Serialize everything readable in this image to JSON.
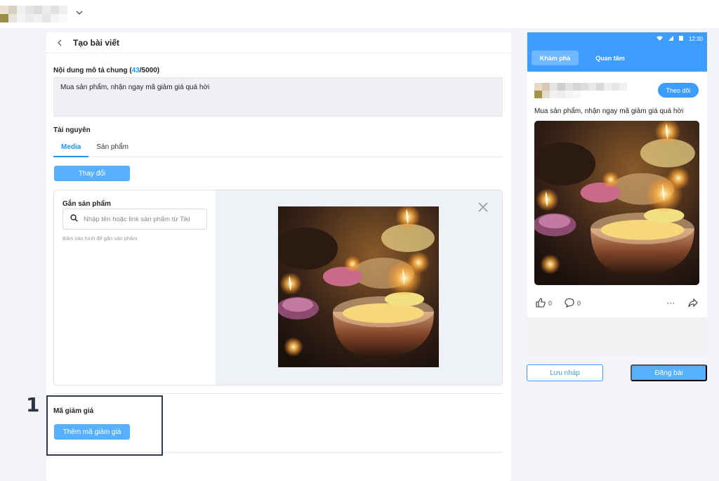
{
  "header": {
    "account_menu_icon": "chevron-down-icon"
  },
  "editor": {
    "title": "Tạo bài viết",
    "description": {
      "label": "Nội dung mô tả chung (",
      "count": "43",
      "limit": "/5000)",
      "value": "Mua sản phẩm, nhận ngay mã giảm giá quá hời"
    },
    "resources": {
      "label": "Tài nguyên",
      "tabs": [
        {
          "label": "Media",
          "active": true
        },
        {
          "label": "Sản phẩm",
          "active": false
        }
      ],
      "change_button": "Thay đổi",
      "attach": {
        "label": "Gắn sản phẩm",
        "placeholder": "Nhập tên hoặc link sản phẩm từ Tiki",
        "hint": "Bấm vào hình để gắn sản phẩm"
      }
    },
    "voucher": {
      "label": "Mã giảm giá",
      "add_button": "Thêm mã giảm giá"
    },
    "step_marker": "1"
  },
  "preview": {
    "status_time": "12:30",
    "tabs": [
      {
        "label": "Khám phá",
        "active": true
      },
      {
        "label": "Quan tâm",
        "active": false
      }
    ],
    "follow_button": "Theo dõi",
    "post_text": "Mua sản phẩm, nhận ngay mã giảm giá quá hời",
    "likes": "0",
    "comments": "0"
  },
  "actions": {
    "save_draft": "Lưu nháp",
    "publish": "Đăng bài"
  },
  "colors": {
    "accent": "#1a94ff",
    "button": "#57b0ff",
    "preview_header": "#3d9dff"
  }
}
